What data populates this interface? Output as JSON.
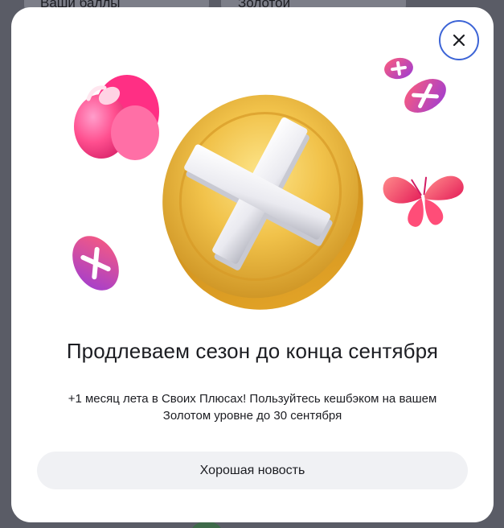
{
  "background": {
    "card_left_text": "Ваши баллы",
    "card_right_text": "Золотой"
  },
  "modal": {
    "close_icon": "close-icon",
    "title": "Продлеваем сезон до конца сентября",
    "subtitle": "+1 месяц лета в Своих Плюсах! Пользуйтесь кешбэком на вашем Золотом уровне до 30 сентября",
    "button_label": "Хорошая новость",
    "illustration": {
      "items": [
        "gold-plus-coin",
        "pink-flower",
        "pink-butterfly",
        "small-plus-token",
        "small-plus-token",
        "small-plus-token"
      ]
    }
  },
  "colors": {
    "close_border": "#3c64d6",
    "button_bg": "#f0f1f4",
    "coin_gold": "#e8b33a",
    "accent_pink": "#ff3d7a"
  }
}
